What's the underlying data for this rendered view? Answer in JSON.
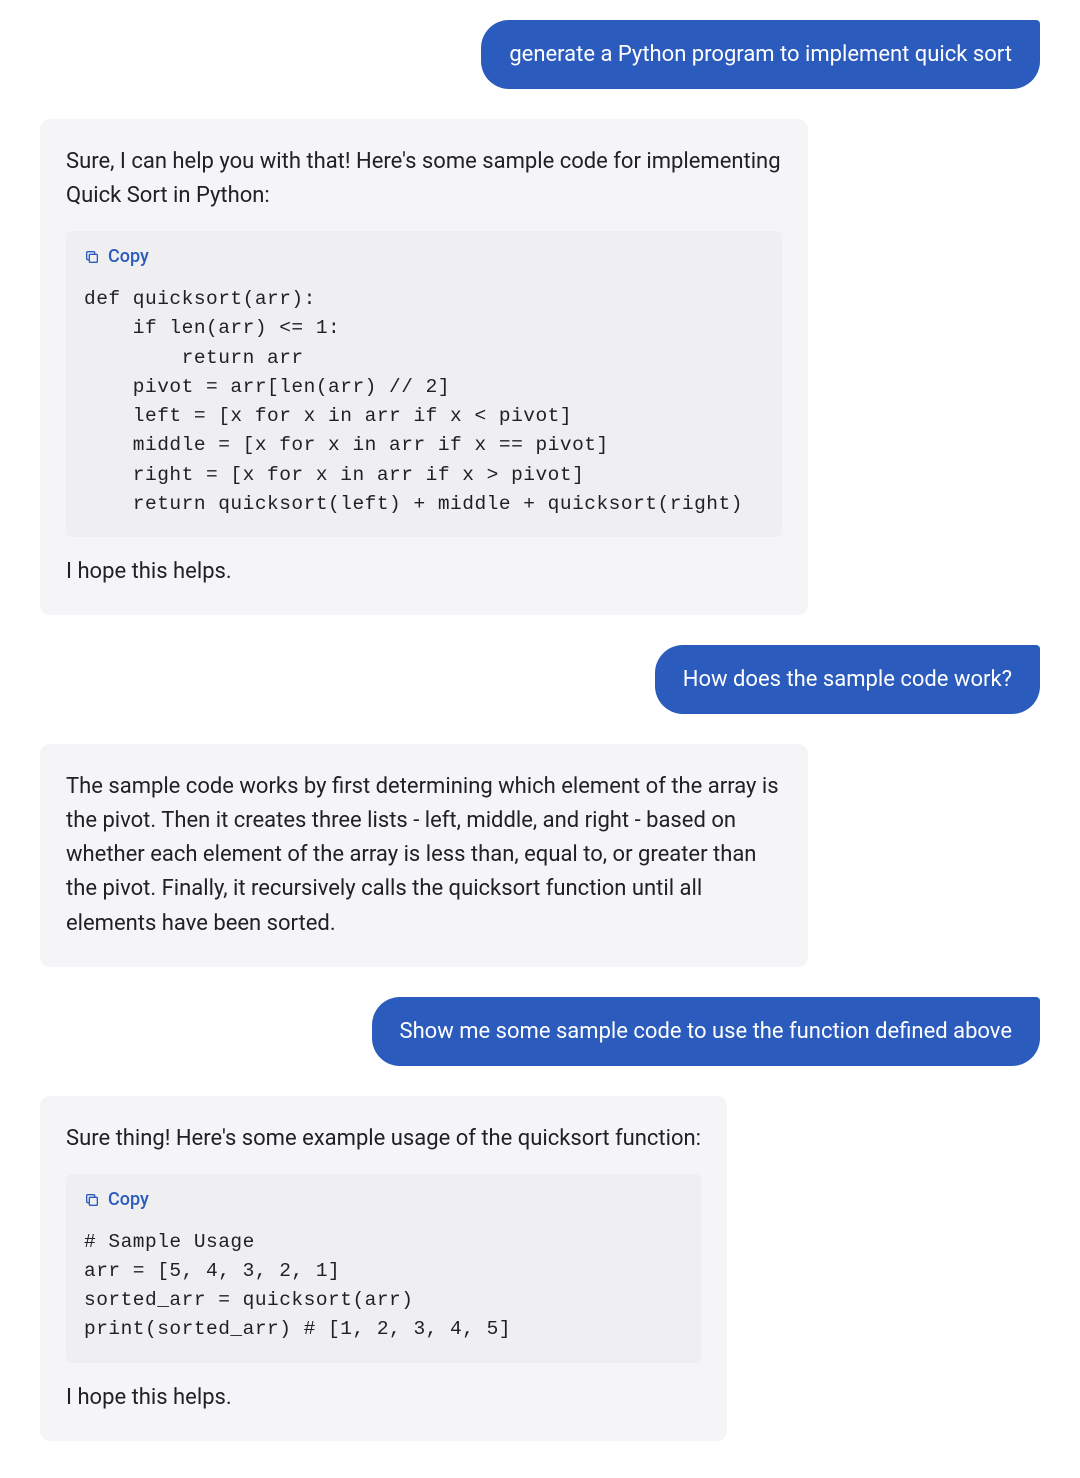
{
  "conversation": [
    {
      "role": "user",
      "text": "generate a Python program to implement quick sort"
    },
    {
      "role": "assistant",
      "intro": "Sure, I can help you with that! Here's some sample code for implementing Quick Sort in Python:",
      "copy_label": "Copy",
      "code": "def quicksort(arr):\n    if len(arr) <= 1:\n        return arr\n    pivot = arr[len(arr) // 2]\n    left = [x for x in arr if x < pivot]\n    middle = [x for x in arr if x == pivot]\n    right = [x for x in arr if x > pivot]\n    return quicksort(left) + middle + quicksort(right)",
      "outro": "I hope this helps."
    },
    {
      "role": "user",
      "text": "How does the sample code work?"
    },
    {
      "role": "assistant",
      "intro": "The sample code works by first determining which element of the array is the pivot. Then it creates three lists - left, middle, and right - based on whether each element of the array is less than, equal to, or greater than the pivot. Finally, it recursively calls the quicksort function until all elements have been sorted."
    },
    {
      "role": "user",
      "text": "Show me some sample code to use the function defined above"
    },
    {
      "role": "assistant",
      "intro": "Sure thing! Here's some example usage of the quicksort function:",
      "copy_label": "Copy",
      "code": "# Sample Usage\narr = [5, 4, 3, 2, 1]\nsorted_arr = quicksort(arr)\nprint(sorted_arr) # [1, 2, 3, 4, 5]",
      "outro": "I hope this helps."
    }
  ],
  "colors": {
    "user_bubble_bg": "#2b5bbd",
    "user_bubble_text": "#ffffff",
    "assistant_bubble_bg": "#f5f5f7",
    "code_bg": "#efeff1",
    "copy_link": "#2b5bbd"
  }
}
